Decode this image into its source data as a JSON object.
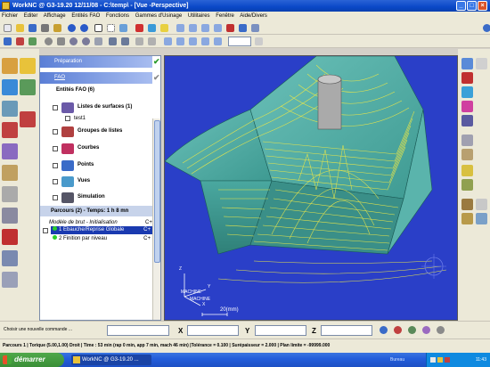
{
  "window": {
    "title": "WorkNC @ G3-19.20  12/11/08 - C:\\temp\\ - [Vue -Perspective]",
    "buttons": [
      "_",
      "□",
      "×"
    ]
  },
  "menu": [
    "Fichier",
    "Editer",
    "Affichage",
    "Entités FAO",
    "Fonctions",
    "Gammes d'Usinage",
    "Utilitaires",
    "Fenêtre",
    "Aide/Divers"
  ],
  "tree": {
    "preparation": "Préparation",
    "fao": "FAO",
    "entites": "Entités FAO (6)",
    "items": [
      {
        "label": "Listes de surfaces (1)",
        "icon": "surface-list-icon",
        "color": "#6b5aa8"
      },
      {
        "label": "Groupes de listes",
        "icon": "list-group-icon",
        "color": "#b04040"
      },
      {
        "label": "Courbes",
        "icon": "curves-icon",
        "color": "#c03060"
      },
      {
        "label": "Points",
        "icon": "points-icon",
        "color": "#3a6bc8"
      },
      {
        "label": "Vues",
        "icon": "views-icon",
        "color": "#4a9acb"
      },
      {
        "label": "Simulation",
        "icon": "simulation-icon",
        "color": "#556"
      }
    ],
    "sub_item": "test1",
    "parcours": {
      "header": "Parcours (2) - Temps: 1 h 8 mn",
      "model": "Modèle de brut - Initialisation",
      "model_badge": "C+",
      "ops": [
        {
          "label": "1 Ebauche/Reprise Globale",
          "badge": "C+",
          "selected": true
        },
        {
          "label": "2 Finition par niveau",
          "badge": "C+",
          "selected": false
        }
      ]
    }
  },
  "viewport": {
    "axis_label": "MACHINE",
    "axis_x": "X",
    "axis_y": "Y",
    "axis_z": "Z",
    "scale_label": "20(mm)"
  },
  "input": {
    "prompt": "Choisir une nouvelle commande ...",
    "x_label": "X",
    "y_label": "Y",
    "z_label": "Z"
  },
  "status": "Parcours 1 | Torique (5.00,1.00) Droit | Time : 53 min (rap 0 min, app 7 min, mach 46 min) |Tolérance = 0.100 | Surépaisseur = 2.000 | Plan limite = -99999.000",
  "taskbar": {
    "start": "démarrer",
    "task": "WorkNC @ G3-19.20 ...",
    "tray_label": "Bureau",
    "clock": "11:43"
  },
  "colors": {
    "viewport_bg": "#2a3fc8",
    "part_surface": "#5fb0a8",
    "toolpath": "#e8e64a",
    "title_bar": "#0a48c8"
  }
}
